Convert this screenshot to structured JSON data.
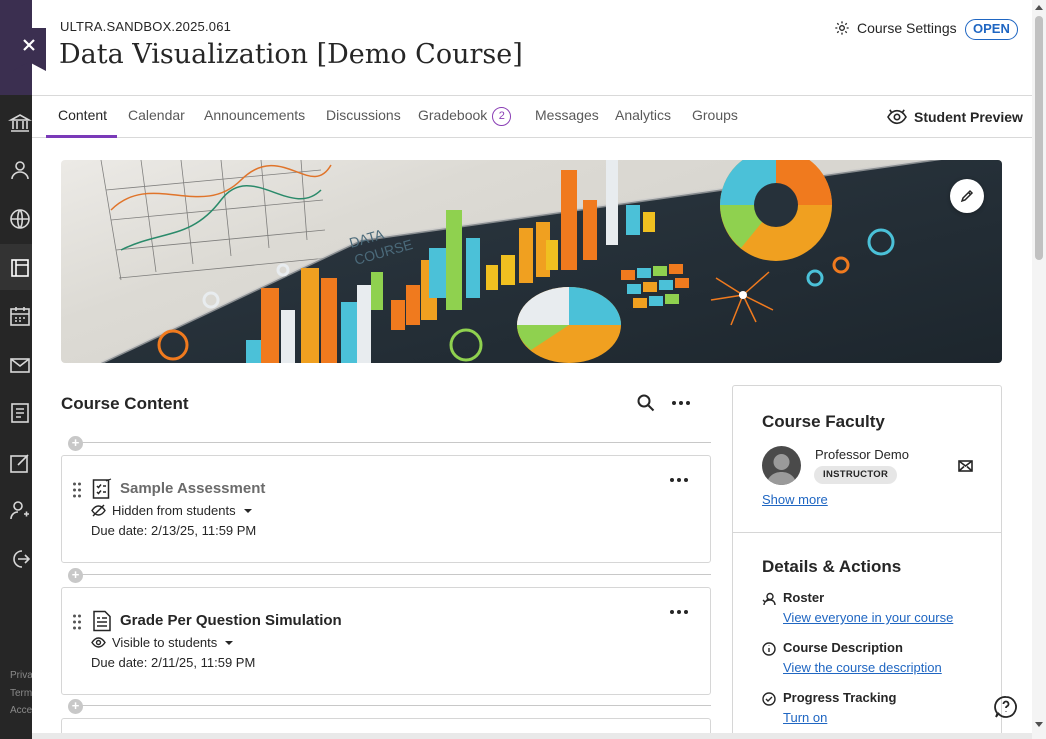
{
  "nav": {
    "footer": [
      "Priva",
      "Term",
      "Acce"
    ]
  },
  "header": {
    "course_id": "ULTRA.SANDBOX.2025.061",
    "course_title": "Data Visualization [Demo Course]",
    "settings_label": "Course Settings",
    "status_badge": "OPEN"
  },
  "tabs": [
    {
      "label": "Content",
      "active": true
    },
    {
      "label": "Calendar"
    },
    {
      "label": "Announcements"
    },
    {
      "label": "Discussions"
    },
    {
      "label": "Gradebook",
      "count": "2"
    },
    {
      "label": "Messages"
    },
    {
      "label": "Analytics"
    },
    {
      "label": "Groups"
    }
  ],
  "student_preview_label": "Student Preview",
  "banner": {
    "text_line1": "DATA",
    "text_line2": "COURSE"
  },
  "course_content": {
    "title": "Course Content",
    "items": [
      {
        "title": "Sample Assessment",
        "visibility": "Hidden from students",
        "due": "Due date: 2/13/25, 11:59 PM",
        "icon": "assessment-icon"
      },
      {
        "title": "Grade Per Question Simulation",
        "visibility": "Visible to students",
        "due": "Due date: 2/11/25, 11:59 PM",
        "icon": "document-icon"
      }
    ]
  },
  "sidebar": {
    "faculty_title": "Course Faculty",
    "professor_name": "Professor Demo",
    "role": "INSTRUCTOR",
    "show_more": "Show more",
    "details_title": "Details & Actions",
    "details": [
      {
        "label": "Roster",
        "link": "View everyone in your course",
        "icon": "roster-icon"
      },
      {
        "label": "Course Description",
        "link": "View the course description",
        "icon": "info-icon"
      },
      {
        "label": "Progress Tracking",
        "link": "Turn on",
        "icon": "check-circle-icon"
      }
    ]
  },
  "colors": {
    "accent": "#7a3ab8",
    "link": "#1f66c2",
    "nav_dark": "#262626",
    "nav_purple": "#3b2f50"
  }
}
